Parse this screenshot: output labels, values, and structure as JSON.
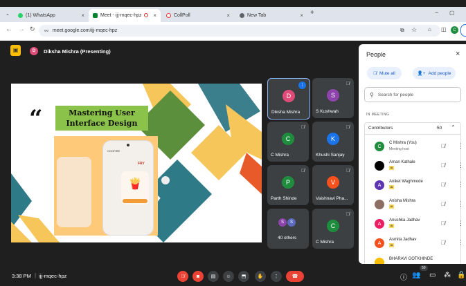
{
  "browser": {
    "tabs": [
      {
        "label": "(1) WhatsApp",
        "color": "#25d366"
      },
      {
        "label": "Meet - ijj-mqec-hpz",
        "color": "#00832d"
      },
      {
        "label": "CollPoll",
        "color": "#e53935"
      },
      {
        "label": "New Tab",
        "color": "#5f6368"
      }
    ],
    "url": "meet.google.com/ijj-mqec-hpz"
  },
  "meet": {
    "presenter_label": "Diksha Mishra (Presenting)",
    "presenter_initial": "D",
    "slide": {
      "quote_mark": "“",
      "title_line1": "Mastering User",
      "title_line2": "Interface Design",
      "phone_text1": "COOFIRE",
      "phone_text2": "FRY"
    },
    "tiles": [
      {
        "name": "Diksha Mishra",
        "initial": "D",
        "color": "#e04b7a"
      },
      {
        "name": "S Kushwah",
        "initial": "S",
        "color": "#8e44ad"
      },
      {
        "name": "C Mishra",
        "initial": "C",
        "color": "#1e8e3e"
      },
      {
        "name": "Khushi Sanjay",
        "initial": "K",
        "color": "#1a73e8"
      },
      {
        "name": "Parth Shinde",
        "initial": "P",
        "color": "#1e8e3e"
      },
      {
        "name": "Vaishnavi Pha...",
        "initial": "V",
        "color": "#f4511e"
      },
      {
        "name": "40 others",
        "initial": "S",
        "initial2": "S",
        "color": "#8e44ad",
        "color2": "#5c6bc0"
      },
      {
        "name": "C Mishra",
        "initial": "C",
        "color": "#1e8e3e"
      }
    ],
    "time": "3:38 PM",
    "meeting_code": "ijj-mqec-hpz",
    "participant_count": "50"
  },
  "people_panel": {
    "title": "People",
    "mute_all": "Mute all",
    "add_people": "Add people",
    "search_placeholder": "Search for people",
    "section": "IN MEETING",
    "group_label": "Contributors",
    "group_count": "50",
    "people": [
      {
        "name": "C Mishra (You)",
        "sub": "Meeting host",
        "initial": "C",
        "color": "#1e8e3e"
      },
      {
        "name": "Aman Kathale",
        "initial": "",
        "color": "#000000"
      },
      {
        "name": "Aniket Waghmode",
        "initial": "A",
        "color": "#5e35b1"
      },
      {
        "name": "Anisha Mishra",
        "initial": "",
        "color": "#8d6e63"
      },
      {
        "name": "Anushka Jadhav",
        "initial": "A",
        "color": "#e91e63"
      },
      {
        "name": "Asmita Jadhav",
        "initial": "A",
        "color": "#f4511e"
      },
      {
        "name": "BHARAVI GOTKHINDE",
        "initial": "",
        "color": "#fbbc04"
      }
    ]
  }
}
